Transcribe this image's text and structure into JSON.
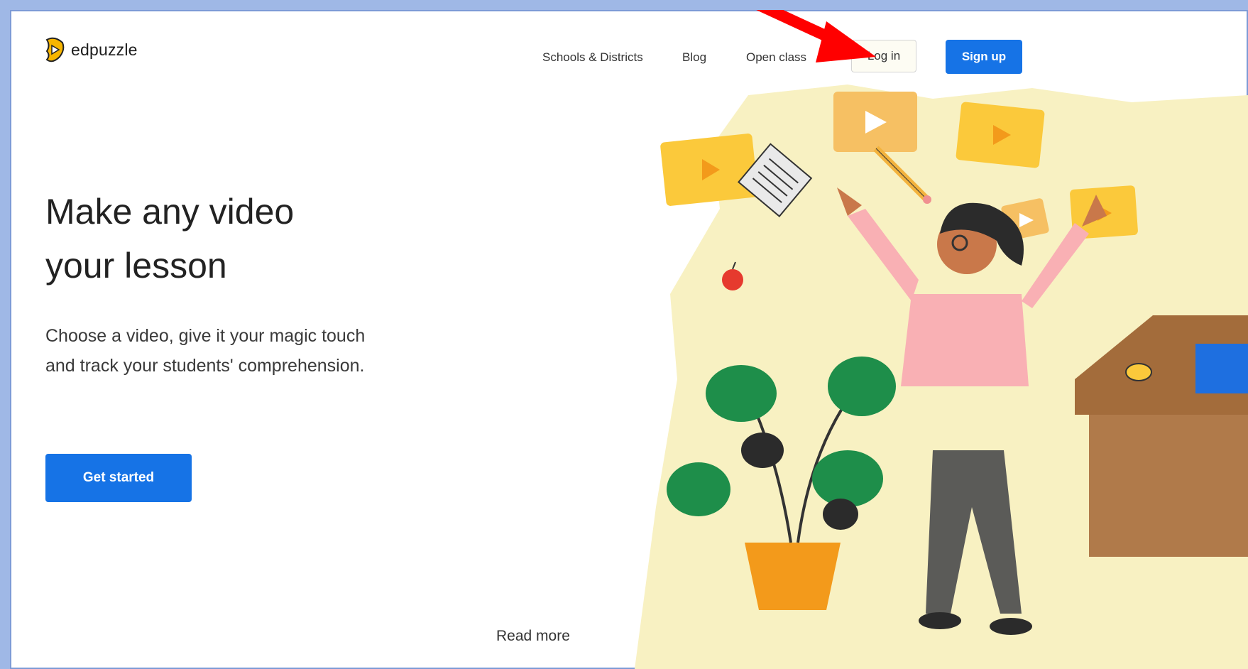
{
  "brand": {
    "name": "edpuzzle",
    "logo_icon": "puzzle-play-icon",
    "color": "#f7b500"
  },
  "nav": {
    "items": [
      "Schools & Districts",
      "Blog",
      "Open class"
    ],
    "login_label": "Log in",
    "signup_label": "Sign up"
  },
  "hero": {
    "headline_line1": "Make any video",
    "headline_line2": "your lesson",
    "subtext": "Choose a video, give it your magic touch and track your students' comprehension.",
    "cta_label": "Get started"
  },
  "footer": {
    "read_more": "Read more"
  },
  "colors": {
    "accent_blue": "#1673e6",
    "annotation_red": "#ff0000",
    "illustration_bg": "#f8f1c2"
  },
  "annotation": {
    "arrow_icon": "red-arrow-pointing-to-login"
  }
}
